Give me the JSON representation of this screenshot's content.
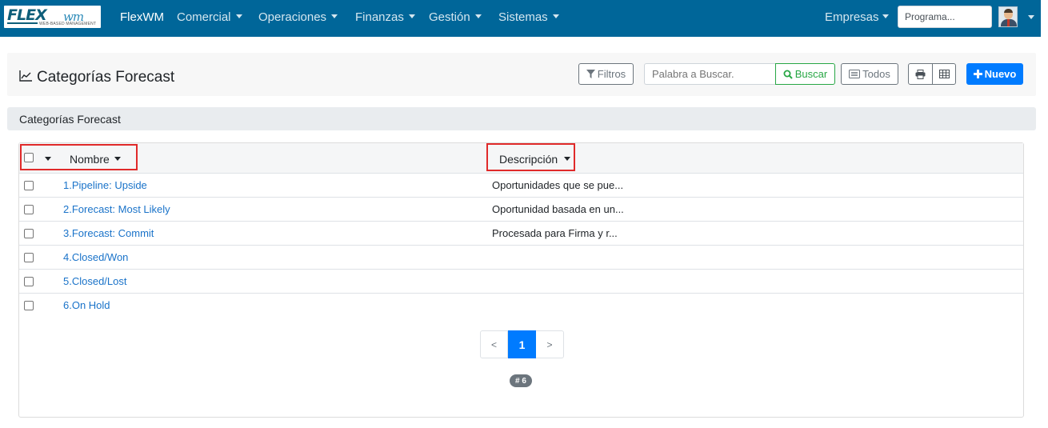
{
  "navbar": {
    "logo_text": "FLEX",
    "logo_wm": "wm",
    "logo_tagline": "WEB-BASED MANAGEMENT",
    "brand": "FlexWM",
    "menus": [
      "Comercial",
      "Operaciones",
      "Finanzas",
      "Gestión",
      "Sistemas"
    ],
    "empresas": "Empresas",
    "search_value": "Programa..."
  },
  "toolbar": {
    "page_title": "Categorías Forecast",
    "filtros_label": "Filtros",
    "search_placeholder": "Palabra a Buscar.",
    "buscar_label": "Buscar",
    "todos_label": "Todos",
    "nuevo_label": "Nuevo"
  },
  "section": {
    "title": "Categorías Forecast"
  },
  "table": {
    "columns": {
      "name": "Nombre",
      "description": "Descripción"
    },
    "rows": [
      {
        "name": "1.Pipeline: Upside",
        "description": "Oportunidades que se pue..."
      },
      {
        "name": "2.Forecast: Most Likely",
        "description": "Oportunidad basada en un..."
      },
      {
        "name": "3.Forecast: Commit",
        "description": "Procesada para Firma y r..."
      },
      {
        "name": "4.Closed/Won",
        "description": ""
      },
      {
        "name": "5.Closed/Lost",
        "description": ""
      },
      {
        "name": "6.On Hold",
        "description": ""
      }
    ]
  },
  "pagination": {
    "prev": "<",
    "current": "1",
    "next": ">",
    "count": "# 6"
  },
  "colors": {
    "navbar": "#006699",
    "primary": "#007bff",
    "success": "#28a745",
    "highlight": "#e02a2a",
    "link": "#1a73c9"
  }
}
